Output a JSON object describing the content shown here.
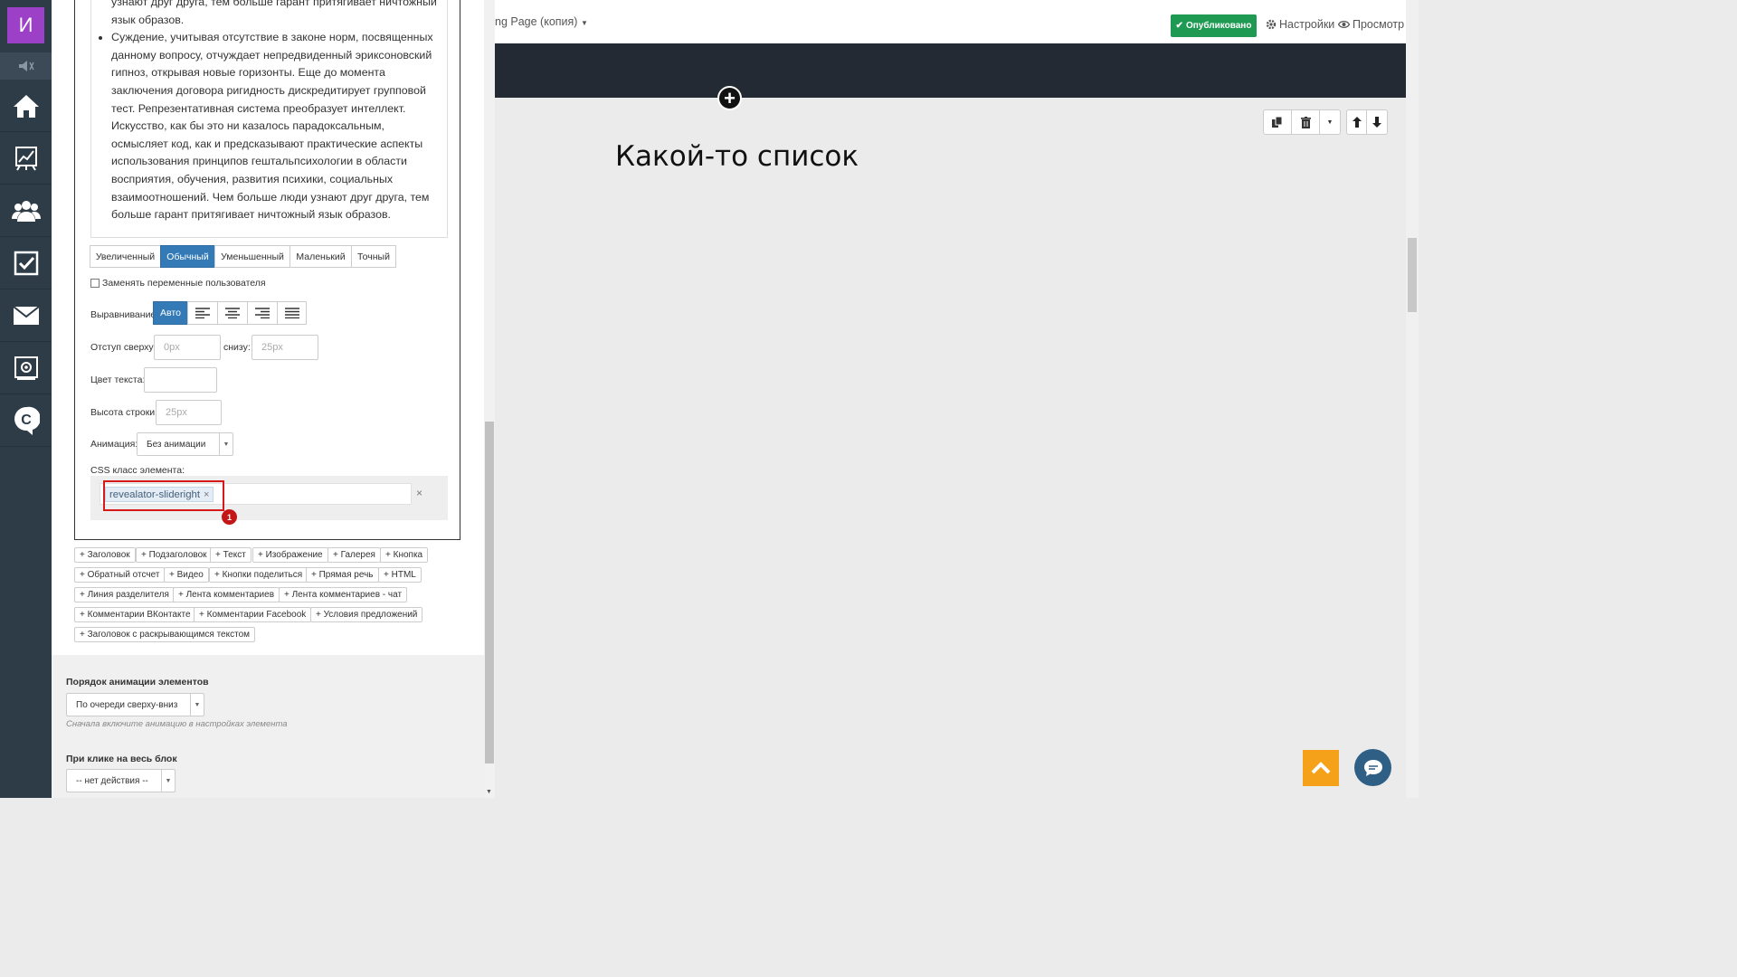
{
  "nav": {
    "logo": "И",
    "items": [
      "home-icon",
      "stats-icon",
      "users-icon",
      "tasks-icon",
      "mail-icon",
      "settings-box-icon",
      "c-logo-icon"
    ]
  },
  "editor": {
    "text_prefix": "узнают друг друга, тем больше гарант притягивает ничтожный язык образов.",
    "bullet_text": "Суждение, учитывая отсутствие в законе норм, посвященных данному вопросу, отчуждает непредвиденный эриксоновский гипноз, открывая новые горизонты. Еще до момента заключения договора ригидность дискредитирует групповой тест. Репрезентативная система преобразует интеллект. Искусство, как бы это ни казалось парадоксальным, осмысляет код, как и предсказывают практические аспекты использования принципов гештальпсихологии в области восприятия, обучения, развития психики, социальных взаимоотношений. Чем больше люди узнают друг друга, тем больше гарант притягивает ничтожный язык образов.",
    "size_buttons": [
      "Увеличенный",
      "Обычный",
      "Уменьшенный",
      "Маленький",
      "Точный"
    ],
    "size_active": "Обычный",
    "replace_vars_label": "Заменять переменные пользователя",
    "align_label": "Выравнивание",
    "align_auto": "Авто",
    "margin_top_label": "Отступ сверху:",
    "margin_top_placeholder": "0px",
    "margin_bottom_label": "снизу:",
    "margin_bottom_placeholder": "25px",
    "text_color_label": "Цвет текста:",
    "line_height_label": "Высота строки:",
    "line_height_placeholder": "25px",
    "animation_label": "Анимация:",
    "animation_value": "Без анимации",
    "css_class_label": "CSS класс элемента:",
    "css_tag": "revealator-slideright",
    "css_tag_remove": "×",
    "css_clear": "×",
    "badge": "1"
  },
  "add_elements": [
    "+ Заголовок",
    "+ Подзаголовок",
    "+ Текст",
    "+ Изображение",
    "+ Галерея",
    "+ Кнопка",
    "+ Обратный отсчет",
    "+ Видео",
    "+ Кнопки поделиться",
    "+ Прямая речь",
    "+ HTML",
    "+ Линия разделителя",
    "+ Лента комментариев",
    "+ Лента комментариев - чат",
    "+ Комментарии ВКонтакте",
    "+ Комментарии Facebook",
    "+ Условия предложений",
    "+ Заголовок с раскрывающимся текстом"
  ],
  "animation_order": {
    "title": "Порядок анимации элементов",
    "value": "По очереди сверху-вниз",
    "hint": "Сначала включите анимацию в настройках элемента"
  },
  "click_block": {
    "title": "При клике на весь блок",
    "value": "-- нет действия --"
  },
  "topbar": {
    "page_name": "ng Page (копия)",
    "publish": "Опубликовано",
    "settings": "Настройки",
    "preview": "Просмотр"
  },
  "preview": {
    "heading": "Какой-то список"
  },
  "colors": {
    "nav_bg": "#2e3c48",
    "logo_bg": "#9c40c7",
    "active_button": "#337ab7",
    "publish_green": "#1e9a53",
    "highlight_red": "#d61a1a",
    "to_top_orange": "#f5a21a",
    "chat_blue": "#2f5f85"
  }
}
